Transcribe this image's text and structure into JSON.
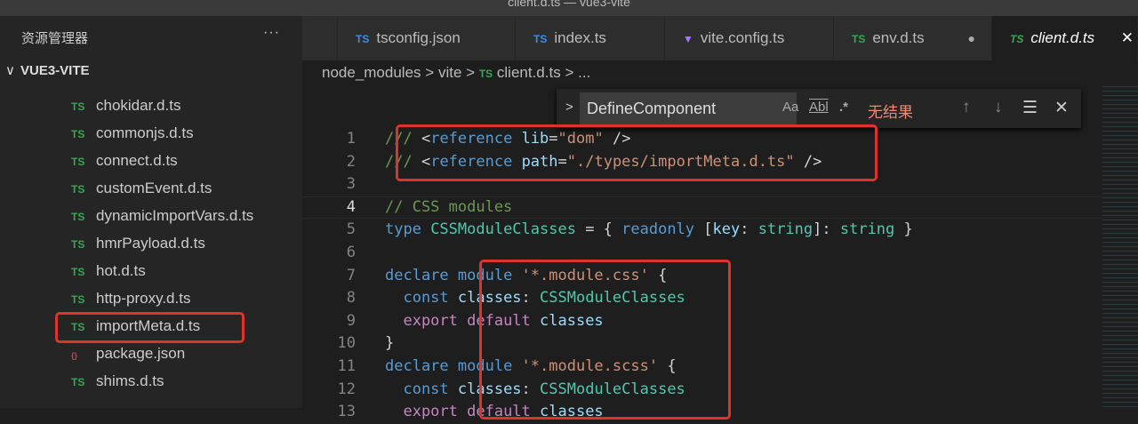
{
  "window_title": "client.d.ts — vue3-vite",
  "sidebar": {
    "title": "资源管理器",
    "more": "···",
    "root": "VUE3-VITE",
    "files": [
      {
        "name": "chokidar.d.ts",
        "icon": "TS"
      },
      {
        "name": "commonjs.d.ts",
        "icon": "TS"
      },
      {
        "name": "connect.d.ts",
        "icon": "TS"
      },
      {
        "name": "customEvent.d.ts",
        "icon": "TS"
      },
      {
        "name": "dynamicImportVars.d.ts",
        "icon": "TS"
      },
      {
        "name": "hmrPayload.d.ts",
        "icon": "TS"
      },
      {
        "name": "hot.d.ts",
        "icon": "TS"
      },
      {
        "name": "http-proxy.d.ts",
        "icon": "TS"
      },
      {
        "name": "importMeta.d.ts",
        "icon": "TS"
      },
      {
        "name": "package.json",
        "icon": "{}"
      },
      {
        "name": "shims.d.ts",
        "icon": "TS"
      }
    ]
  },
  "tabs": [
    {
      "label": "tsconfig.json",
      "icon": "TS",
      "color": "#3b8eea"
    },
    {
      "label": "index.ts",
      "icon": "TS",
      "color": "#3b8eea"
    },
    {
      "label": "vite.config.ts",
      "icon": "▼",
      "color": "#a974ff"
    },
    {
      "label": "env.d.ts",
      "icon": "TS",
      "color": "#36a852",
      "dirty": "●"
    },
    {
      "label": "client.d.ts",
      "icon": "TS",
      "color": "#36a852",
      "close": "✕",
      "active": true
    }
  ],
  "breadcrumb": {
    "a": "node_modules",
    "b": "vite",
    "ts": "TS",
    "c": "client.d.ts",
    "d": "...",
    "sep": ">"
  },
  "find": {
    "value": "DefineComponent",
    "case": "Aa",
    "word": "Abl",
    "regex": ".*",
    "result": "无结果",
    "prev": "↑",
    "next": "↓",
    "selection": "☰",
    "close": "✕",
    "toggle": ">"
  },
  "code": [
    [
      [
        "/// ",
        "c"
      ],
      [
        "<",
        "p"
      ],
      [
        "reference ",
        "tag"
      ],
      [
        "lib",
        "a"
      ],
      [
        "=",
        "p"
      ],
      [
        "\"dom\"",
        "s"
      ],
      [
        " />",
        "p"
      ]
    ],
    [
      [
        "/// ",
        "c"
      ],
      [
        "<",
        "p"
      ],
      [
        "reference ",
        "tag"
      ],
      [
        "path",
        "a"
      ],
      [
        "=",
        "p"
      ],
      [
        "\"./types/importMeta.d.ts\"",
        "s"
      ],
      [
        " />",
        "p"
      ]
    ],
    [],
    [
      [
        "// CSS modules",
        "c"
      ]
    ],
    [
      [
        "type ",
        "k"
      ],
      [
        "CSSModuleClasses",
        "t"
      ],
      [
        " = { ",
        "p"
      ],
      [
        "readonly ",
        "k"
      ],
      [
        "[",
        "p"
      ],
      [
        "key",
        "v"
      ],
      [
        ": ",
        "p"
      ],
      [
        "string",
        "t"
      ],
      [
        "]: ",
        "p"
      ],
      [
        "string",
        "t"
      ],
      [
        " }",
        "p"
      ]
    ],
    [],
    [
      [
        "declare ",
        "k"
      ],
      [
        "module ",
        "k"
      ],
      [
        "'*.module.css'",
        "s"
      ],
      [
        " {",
        "p"
      ]
    ],
    [
      [
        "  const ",
        "k"
      ],
      [
        "classes",
        "v"
      ],
      [
        ": ",
        "p"
      ],
      [
        "CSSModuleClasses",
        "t"
      ]
    ],
    [
      [
        "  export ",
        "m"
      ],
      [
        "default ",
        "m"
      ],
      [
        "classes",
        "v"
      ]
    ],
    [
      [
        "}",
        "p"
      ]
    ],
    [
      [
        "declare ",
        "k"
      ],
      [
        "module ",
        "k"
      ],
      [
        "'*.module.scss'",
        "s"
      ],
      [
        " {",
        "p"
      ]
    ],
    [
      [
        "  const ",
        "k"
      ],
      [
        "classes",
        "v"
      ],
      [
        ": ",
        "p"
      ],
      [
        "CSSModuleClasses",
        "t"
      ]
    ],
    [
      [
        "  export ",
        "m"
      ],
      [
        "default ",
        "m"
      ],
      [
        "classes",
        "v"
      ]
    ]
  ]
}
